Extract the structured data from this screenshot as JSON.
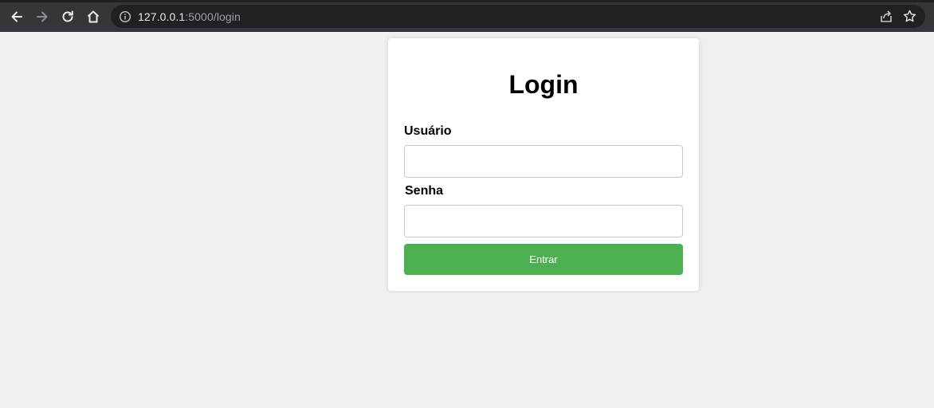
{
  "browser": {
    "url_host": "127.0.0.1",
    "url_rest": ":5000/login",
    "icons": [
      "back-icon",
      "forward-icon",
      "reload-icon",
      "home-icon",
      "info-icon",
      "share-icon",
      "star-icon"
    ]
  },
  "login": {
    "title": "Login",
    "username_label": "Usuário",
    "username_value": "",
    "password_label": "Senha",
    "password_value": "",
    "submit_label": "Entrar"
  },
  "colors": {
    "page_bg": "#f0f0f0",
    "card_bg": "#ffffff",
    "button_bg": "#4caf50",
    "toolbar_bg": "#35363a"
  }
}
